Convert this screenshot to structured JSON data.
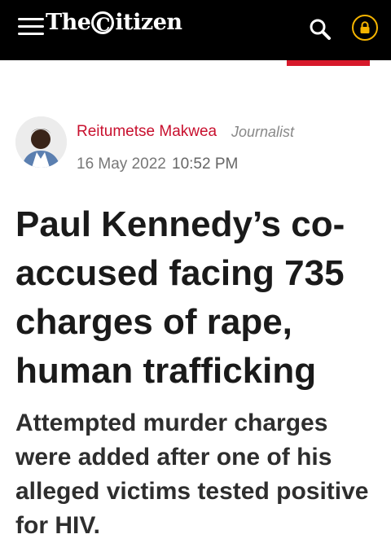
{
  "header": {
    "logo_text": {
      "pre": "The",
      "c": "C",
      "post": "itizen"
    },
    "colors": {
      "background": "#000000",
      "lock_accent": "#f5b400",
      "tab_accent": "#d7192b"
    },
    "icons": [
      "menu-icon",
      "search-icon",
      "lock-icon"
    ]
  },
  "article": {
    "author": {
      "name": "Reitumetse Makwea",
      "role": "Journalist"
    },
    "date": "16 May 2022",
    "time": "10:52 PM",
    "headline": "Paul Kennedy’s co-accused facing 735 charges of rape, human trafficking",
    "subheadline": "Attempted murder charges were added after one of his alleged victims tested positive for HIV."
  }
}
